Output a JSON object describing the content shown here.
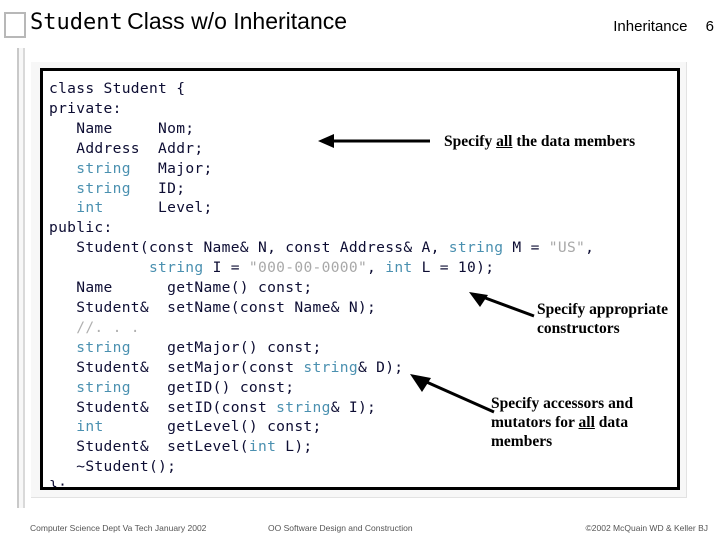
{
  "header": {
    "title_mono": "Student",
    "title_sans": "Class w/o Inheritance",
    "section": "Inheritance",
    "page_number": "6"
  },
  "code": {
    "lines": [
      "class Student {",
      "private:",
      "   Name     Nom;",
      "   Address  Addr;",
      "   string   Major;",
      "   string   ID;",
      "   int      Level;",
      "public:",
      "   Student(const Name& N, const Address& A, string M = \"US\",",
      "           string I = \"000-00-0000\", int L = 10);",
      "   Name      getName() const;",
      "   Student&  setName(const Name& N);",
      "   //. . .",
      "   string    getMajor() const;",
      "   Student&  setMajor(const string& D);",
      "   string    getID() const;",
      "   Student&  setID(const string& I);",
      "   int       getLevel() const;",
      "   Student&  setLevel(int L);",
      "   ~Student();",
      "};"
    ]
  },
  "annotations": {
    "data_members": {
      "before": "Specify ",
      "emphasis": "all",
      "after": " the data members"
    },
    "constructors": {
      "text": "Specify appropriate constructors"
    },
    "accessors": {
      "before": "Specify accessors and mutators for ",
      "emphasis": "all",
      "after": " data members"
    }
  },
  "footer": {
    "left": "Computer Science Dept Va Tech January 2002",
    "center": "OO Software Design and Construction",
    "right": "©2002  McQuain WD & Keller BJ"
  },
  "colors": {
    "keyword": "#4a90b0",
    "literal": "#a8a8a8",
    "code_text": "#0d0d33",
    "border": "#000000"
  }
}
